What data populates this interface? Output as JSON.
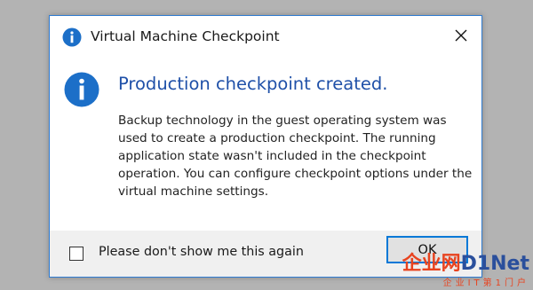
{
  "dialog": {
    "title": "Virtual Machine Checkpoint",
    "close_symbol": "✕",
    "title_icon": "info-icon",
    "heading": "Production checkpoint created.",
    "message": "Backup technology in the guest operating system was used to create a production checkpoint. The running application state wasn't included in the checkpoint operation. You can configure checkpoint options under the virtual machine settings.",
    "checkbox_label": "Please don't show me this again",
    "checkbox_checked": false,
    "ok_label": "OK"
  },
  "watermark": {
    "brand_cn": "企业网",
    "brand_en": "D1Net",
    "subtitle": "企业IT第1门户"
  },
  "colors": {
    "accent": "#0078d7",
    "heading": "#1f50a8",
    "info_icon": "#1c6fc8",
    "background": "#b3b3b3"
  }
}
